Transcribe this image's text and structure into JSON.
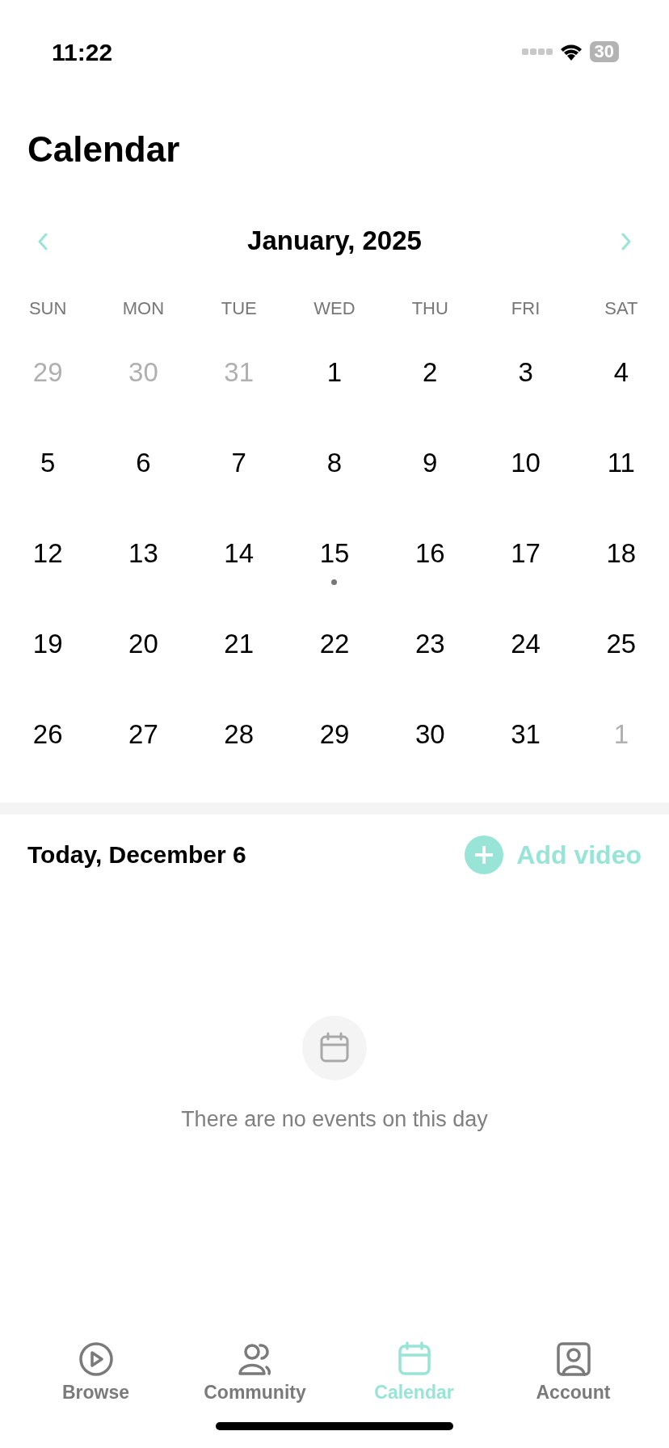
{
  "status_bar": {
    "time": "11:22",
    "battery": "30"
  },
  "title": "Calendar",
  "month": {
    "label": "January, 2025",
    "weekdays": [
      "SUN",
      "MON",
      "TUE",
      "WED",
      "THU",
      "FRI",
      "SAT"
    ],
    "days": [
      {
        "label": "29",
        "muted": true,
        "has_event": false
      },
      {
        "label": "30",
        "muted": true,
        "has_event": false
      },
      {
        "label": "31",
        "muted": true,
        "has_event": false
      },
      {
        "label": "1",
        "muted": false,
        "has_event": false
      },
      {
        "label": "2",
        "muted": false,
        "has_event": false
      },
      {
        "label": "3",
        "muted": false,
        "has_event": false
      },
      {
        "label": "4",
        "muted": false,
        "has_event": false
      },
      {
        "label": "5",
        "muted": false,
        "has_event": false
      },
      {
        "label": "6",
        "muted": false,
        "has_event": false
      },
      {
        "label": "7",
        "muted": false,
        "has_event": false
      },
      {
        "label": "8",
        "muted": false,
        "has_event": false
      },
      {
        "label": "9",
        "muted": false,
        "has_event": false
      },
      {
        "label": "10",
        "muted": false,
        "has_event": false
      },
      {
        "label": "11",
        "muted": false,
        "has_event": false
      },
      {
        "label": "12",
        "muted": false,
        "has_event": false
      },
      {
        "label": "13",
        "muted": false,
        "has_event": false
      },
      {
        "label": "14",
        "muted": false,
        "has_event": false
      },
      {
        "label": "15",
        "muted": false,
        "has_event": true
      },
      {
        "label": "16",
        "muted": false,
        "has_event": false
      },
      {
        "label": "17",
        "muted": false,
        "has_event": false
      },
      {
        "label": "18",
        "muted": false,
        "has_event": false
      },
      {
        "label": "19",
        "muted": false,
        "has_event": false
      },
      {
        "label": "20",
        "muted": false,
        "has_event": false
      },
      {
        "label": "21",
        "muted": false,
        "has_event": false
      },
      {
        "label": "22",
        "muted": false,
        "has_event": false
      },
      {
        "label": "23",
        "muted": false,
        "has_event": false
      },
      {
        "label": "24",
        "muted": false,
        "has_event": false
      },
      {
        "label": "25",
        "muted": false,
        "has_event": false
      },
      {
        "label": "26",
        "muted": false,
        "has_event": false
      },
      {
        "label": "27",
        "muted": false,
        "has_event": false
      },
      {
        "label": "28",
        "muted": false,
        "has_event": false
      },
      {
        "label": "29",
        "muted": false,
        "has_event": false
      },
      {
        "label": "30",
        "muted": false,
        "has_event": false
      },
      {
        "label": "31",
        "muted": false,
        "has_event": false
      },
      {
        "label": "1",
        "muted": true,
        "has_event": false
      }
    ]
  },
  "day_panel": {
    "heading": "Today, December 6",
    "action": "Add video",
    "empty_message": "There are no events on this day"
  },
  "tabs": [
    {
      "label": "Browse",
      "kind": "play",
      "selected": false
    },
    {
      "label": "Community",
      "kind": "people",
      "selected": false
    },
    {
      "label": "Calendar",
      "kind": "calendar",
      "selected": true
    },
    {
      "label": "Account",
      "kind": "account",
      "selected": false
    }
  ]
}
